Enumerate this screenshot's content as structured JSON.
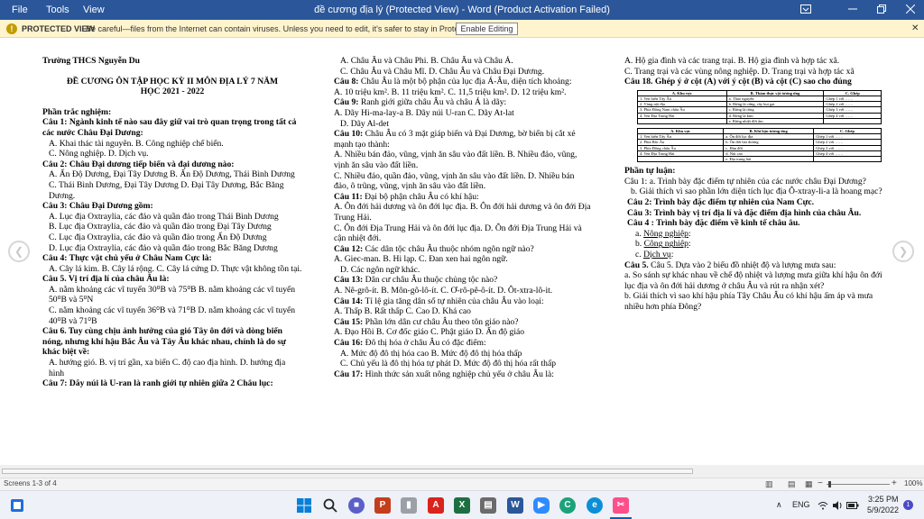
{
  "titlebar": {
    "menus": [
      "File",
      "Tools",
      "View"
    ],
    "title": "đề cương địa lý (Protected View) - Word (Product Activation Failed)"
  },
  "protected_view": {
    "label": "PROTECTED VIEW",
    "message": "Be careful—files from the Internet can contain viruses. Unless you need to edit, it's safer to stay in Protected View.",
    "button": "Enable Editing"
  },
  "page1": {
    "school": "Trường THCS Nguyễn Du",
    "title1": "ĐỀ CƯƠNG ÔN TẬP HỌC KỲ II MÔN ĐỊA LÝ 7 NĂM",
    "title2": "HỌC 2021 - 2022",
    "section": "Phần trắc nghiệm:",
    "lines": [
      {
        "t": "Câu 1: Ngành kinh tế nào sau đây giữ vai trò quan trọng trong tất cả các nước Châu Đại Dương:",
        "b": true
      },
      {
        "t": "A. Khai thác tài nguyên. B. Công nghiệp chế biến.",
        "i": true
      },
      {
        "t": "C. Nông nghiệp. D. Dịch vụ.",
        "i": true
      },
      {
        "t": "Câu 2: Châu Đại dương tiếp biển và đại dương nào:",
        "b": true
      },
      {
        "t": "A. Ấn Độ Dương, Đại Tây Dương      B. Ấn Độ Dương, Thái Bình Dương",
        "i": true
      },
      {
        "t": "C. Thái Bình Dương, Đại Tây Dương      D. Đại Tây Dương, Bắc Băng Dương.",
        "i": true
      },
      {
        "t": "Câu 3: Châu Đại Dương gồm:",
        "b": true
      },
      {
        "t": "A. Lục địa Oxtraylia, các đảo và quần đảo trong Thái Bình Dương",
        "i": true
      },
      {
        "t": "B. Lục địa Oxtraylia, các đảo và quần đảo trong Đại Tây Dương",
        "i": true
      },
      {
        "t": "C. Lục địa Oxtraylia, các đảo và quần đảo trong Ấn Độ Dương",
        "i": true
      },
      {
        "t": "D. Lục địa Oxtraylia, các đảo và quần đảo trong Bắc Băng Dương",
        "i": true
      },
      {
        "t": "Câu 4: Thực vật chủ yếu ở Châu Nam Cực là:",
        "b": true
      },
      {
        "t": "A. Cây lá kim. B. Cây lá rộng. C. Cây lá cứng        D. Thực vật không tồn tại.",
        "i": true
      },
      {
        "t": "Câu 5. Vị trí địa lí của châu Âu là:",
        "b": true
      },
      {
        "t": "A. nằm khoảng các vĩ tuyến 30⁰B và 75⁰B       B. nằm khoảng các vĩ tuyến 50⁰B và 5⁰N",
        "i": true
      },
      {
        "t": "C. nằm khoảng các vĩ tuyến 36⁰B và 71⁰B       D. nằm khoảng các vĩ tuyến 40⁰B và 71⁰B",
        "i": true
      },
      {
        "t": "Câu 6. Tuy cùng chịu ảnh hưởng của gió Tây ôn đới và dòng biển nóng, nhưng khí hậu Bắc Âu và Tây Âu khác nhau, chính là do sự khác biệt về:",
        "b": true
      },
      {
        "t": "A. hướng gió.      B. vị trí gần, xa biển      C. độ cao địa hình.       D. hướng địa hình",
        "i": true
      },
      {
        "t": "Câu 7: Dãy núi là U-ran là ranh giới tự nhiên giữa 2 Châu lục:",
        "b": true
      }
    ]
  },
  "page2": {
    "lines": [
      {
        "t": "A. Châu Âu và Châu Phi.        B. Châu Âu và Châu Á.",
        "i": true
      },
      {
        "t": "C. Châu Âu và Châu Mĩ.    D. Châu Âu và Châu Đại Dương.",
        "i": true
      },
      {
        "t": "Câu 8: Châu Âu là một bộ phận của lục địa Á-Âu, diện tích khoảng:",
        "q": true
      },
      {
        "t": "A. 10 triệu km². B. 11 triệu km². C. 11,5 triệu km².    D. 12 triệu km²."
      },
      {
        "t": "Câu 9: Ranh giới giữa châu Âu và châu Á là dãy:",
        "q": true
      },
      {
        "t": "A. Dãy Hi-ma-lay-a       B. Dãy núi U-ran      C. Dãy At-lat"
      },
      {
        "t": "D. Dãy Al-det",
        "i": true
      },
      {
        "t": "Câu 10: Châu Âu có 3 mặt giáp biển và Đại Dương, bờ biển bị cắt xẻ mạnh tạo thành:",
        "q": true
      },
      {
        "t": "A. Nhiều bán đảo, vũng, vịnh ăn sâu vào đất liền.        B. Nhiều đảo, vũng, vịnh ăn sâu vào đất liền."
      },
      {
        "t": "C. Nhiều đảo, quần đảo, vũng, vịnh ăn sâu vào đất liền.   D. Nhiều bán đảo, ô trũng, vũng, vịnh ăn sâu vào đất liền."
      },
      {
        "t": "Câu 11: Đại bộ phận châu Âu có khí hậu:",
        "q": true
      },
      {
        "t": "A. Ôn đới hải dương và ôn đới lục địa.      B. Ôn đới hải dương và ôn đới Địa Trung Hải."
      },
      {
        "t": "C. Ôn đới Địa Trung Hải và ôn đới lục địa.      D. Ôn đới Địa Trung Hải và cận nhiệt đới."
      },
      {
        "t": "Câu 12: Các dân tộc châu Âu thuộc nhóm ngôn ngữ nào?",
        "q": true
      },
      {
        "t": "A. Giec-man.        B. Hi lạp.     C. Đan xen hai ngôn ngữ."
      },
      {
        "t": "D. Các ngôn ngữ khác.",
        "i": true
      },
      {
        "t": "Câu 13: Dân cư châu Âu thuộc chủng tộc nào?",
        "q": true
      },
      {
        "t": "A. Nê-grô-ít.       B. Môn-gô-lô-ít.  C. Ơ-rô-pê-ô-ít.   D. Ôt-xtra-lô-it."
      },
      {
        "t": "Câu 14: Tỉ lệ gia tăng dân số tự nhiên của châu Âu vào loại:",
        "q": true
      },
      {
        "t": "A. Thấp         B. Rất thấp         C. Cao              D. Khá cao"
      },
      {
        "t": "Câu 15: Phần lớn dân cư châu Âu theo tôn giáo nào?",
        "q": true
      },
      {
        "t": "A. Đạo Hồi            B. Cơ đốc giáo    C. Phật giáo               D. Ấn độ giáo"
      },
      {
        "t": "Câu 16: Đô thị hóa ở châu Âu có đặc điểm:",
        "q": true
      },
      {
        "t": "A. Mức độ đô thị hóa cao             B. Mức độ đô thị hóa thấp",
        "i": true
      },
      {
        "t": "C. Chủ yếu là đô thị hóa tự phát       D. Mức độ đô thị hóa rất thấp",
        "i": true
      },
      {
        "t": "Câu 17: Hình thức sản xuất nông nghiệp chủ yếu ở châu Âu là:",
        "q": true
      }
    ]
  },
  "page3": {
    "lines_top": [
      {
        "t": "A. Hộ gia đình và các trang trại.          B. Hộ gia đình và hợp tác xã."
      },
      {
        "t": "C. Trang trại và các vùng nông nghiệp.          D. Trang trại và hợp tác xã"
      }
    ],
    "q18": "Câu 18. Ghép ý ở cột (A) với ý cột (B) và cột (C) sao cho đúng",
    "table1": {
      "headers": [
        "A. Khu vực",
        "B. Thảm thực vật tương ứng",
        "C. Ghép"
      ],
      "rows": [
        [
          "1. Ven biển Tây Âu",
          "a. Thảo nguyên",
          "Ghép 1 với ……"
        ],
        [
          "2. Vùng nội địa",
          "b. Rừng lá cứng, cây bụi gai",
          "Ghép 2 với ……"
        ],
        [
          "3. Phía Đông Nam châu Âu",
          "c. Rừng lá rộng",
          "Ghép 3 với ……"
        ],
        [
          "4. Ven Địa Trung Hải",
          "d. Rừng lá kim",
          "Ghép 4 với ……"
        ],
        [
          "",
          "e. Rừng nhiệt đới ẩm",
          ""
        ]
      ]
    },
    "table2": {
      "headers": [
        "A. Khu vực",
        "B. Khí hậu tương ứng",
        "C. Ghép"
      ],
      "rows": [
        [
          "1. Ven biển Tây Âu",
          "a. Ôn đới lục địa",
          "Ghép 1 với ……"
        ],
        [
          "2. Phía Bắc Âu",
          "b. Ôn đới hải dương",
          "Ghép 2 với ……"
        ],
        [
          "3. Phía Đông châu Âu",
          "c. Hàn đới",
          "Ghép 3 với ……"
        ],
        [
          "4. Ven Địa Trung Hải",
          "d. Núi cao",
          "Ghép 4 với ……"
        ],
        [
          "",
          "e. Địa trung hải",
          ""
        ]
      ]
    },
    "section2": "Phần tự luận:",
    "c1a": "Câu 1: a. Trình bày đặc điểm tự nhiên của các nước châu Đại Dương?",
    "c1b": "b. Giải thích vì sao phần lớn diện tích lục địa Ô-xtray-li-a là hoang mạc?",
    "c2": "Câu 2: Trình bày đặc điểm tự nhiên của Nam Cực.",
    "c3": "Câu 3: Trình bày vị trí địa lí và đặc điểm địa hình của châu Âu.",
    "c4": "Câu 4 : Trình bày đặc điểm về kinh tế châu âu.",
    "c4a": "Nông nghiệp",
    "c4b": "Công nghiệp",
    "c4c": "Dịch vụ",
    "c5": "Câu 5. Dựa vào 2 biểu đồ nhiệt độ và lượng mưa sau:",
    "c5a": "a. So sánh sự khác nhau về chế độ nhiệt và lượng mưa giữa khí hậu ôn đới lục địa và ôn đới hải dương ở châu Âu và rút ra nhận xét?",
    "c5b": "b. Giải thích vì sao khí hậu phía Tây Châu Âu có khí hậu ấm áp và mưa nhiều hơn phía Đông?"
  },
  "status": {
    "screens": "Screens 1-3 of 4",
    "zoom": "100%"
  },
  "taskbar": {
    "lang": "ENG",
    "time": "3:25 PM",
    "date": "5/9/2022",
    "badge": "1"
  }
}
